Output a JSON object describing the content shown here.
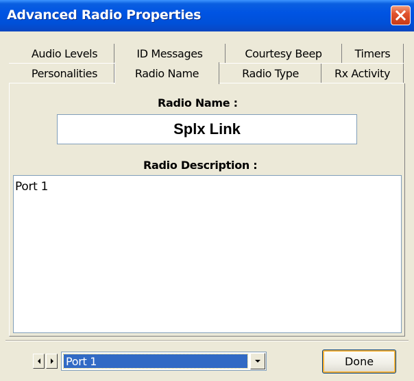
{
  "window": {
    "title": "Advanced Radio Properties",
    "close_icon": "close-x-icon"
  },
  "tabs": {
    "row1": [
      {
        "label": "Audio Levels"
      },
      {
        "label": "ID Messages"
      },
      {
        "label": "Courtesy Beep"
      },
      {
        "label": "Timers"
      }
    ],
    "row2": [
      {
        "label": "Personalities"
      },
      {
        "label": "Radio Name",
        "selected": true
      },
      {
        "label": "Radio Type"
      },
      {
        "label": "Rx Activity"
      }
    ]
  },
  "form": {
    "radio_name_label": "Radio Name :",
    "radio_name_value": "Splx Link",
    "radio_description_label": "Radio Description :",
    "radio_description_value": "Port 1"
  },
  "footer": {
    "prev_icon": "arrow-left-icon",
    "next_icon": "arrow-right-icon",
    "port_selected": "Port 1",
    "done_label": "Done"
  },
  "colors": {
    "titlebar": "#0054E3",
    "face": "#ECE9D8",
    "selection": "#316AC5"
  }
}
